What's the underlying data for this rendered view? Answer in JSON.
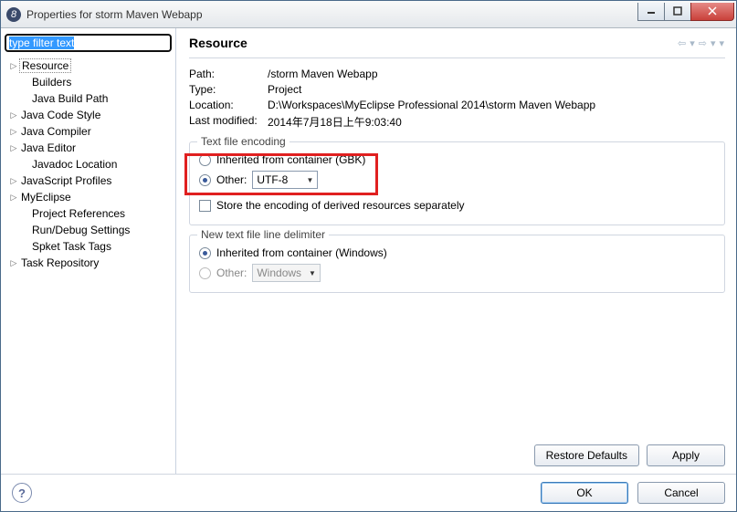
{
  "window": {
    "title": "Properties for storm Maven Webapp"
  },
  "sidebar": {
    "filter_placeholder": "type filter text",
    "items": [
      {
        "label": "Resource",
        "expandable": true,
        "selected": true,
        "indent": 0
      },
      {
        "label": "Builders",
        "expandable": false,
        "indent": 1
      },
      {
        "label": "Java Build Path",
        "expandable": false,
        "indent": 1
      },
      {
        "label": "Java Code Style",
        "expandable": true,
        "indent": 0
      },
      {
        "label": "Java Compiler",
        "expandable": true,
        "indent": 0
      },
      {
        "label": "Java Editor",
        "expandable": true,
        "indent": 0
      },
      {
        "label": "Javadoc Location",
        "expandable": false,
        "indent": 1
      },
      {
        "label": "JavaScript Profiles",
        "expandable": true,
        "indent": 0
      },
      {
        "label": "MyEclipse",
        "expandable": true,
        "indent": 0
      },
      {
        "label": "Project References",
        "expandable": false,
        "indent": 1
      },
      {
        "label": "Run/Debug Settings",
        "expandable": false,
        "indent": 1
      },
      {
        "label": "Spket Task Tags",
        "expandable": false,
        "indent": 1
      },
      {
        "label": "Task Repository",
        "expandable": true,
        "indent": 0
      }
    ]
  },
  "main": {
    "heading": "Resource",
    "props": {
      "path_label": "Path:",
      "path_value": "/storm Maven Webapp",
      "type_label": "Type:",
      "type_value": "Project",
      "location_label": "Location:",
      "location_value": "D:\\Workspaces\\MyEclipse Professional 2014\\storm Maven Webapp",
      "modified_label": "Last modified:",
      "modified_value": "2014年7月18日上午9:03:40"
    },
    "encoding": {
      "legend": "Text file encoding",
      "inherited_label": "Inherited from container (GBK)",
      "other_label": "Other:",
      "other_value": "UTF-8",
      "derived_label": "Store the encoding of derived resources separately"
    },
    "delimiter": {
      "legend": "New text file line delimiter",
      "inherited_label": "Inherited from container (Windows)",
      "other_label": "Other:",
      "other_value": "Windows"
    },
    "buttons": {
      "restore": "Restore Defaults",
      "apply": "Apply"
    }
  },
  "footer": {
    "ok": "OK",
    "cancel": "Cancel"
  }
}
